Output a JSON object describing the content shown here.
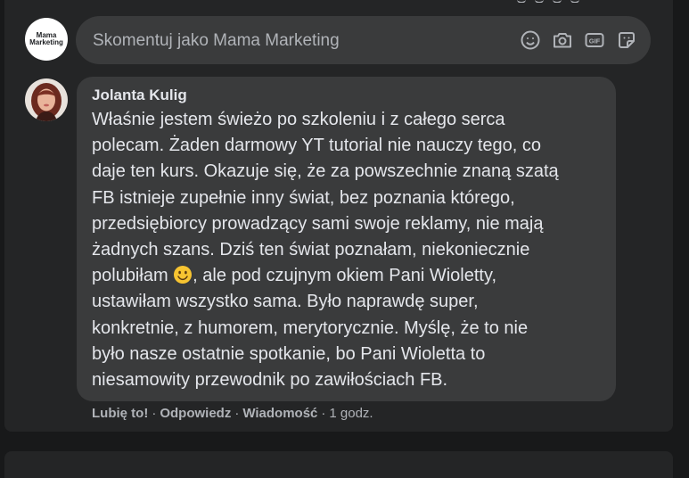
{
  "composer": {
    "placeholder": "Skomentuj jako Mama Marketing",
    "avatar_line1": "Mama",
    "avatar_line2": "Marketing",
    "icons": [
      "emoji-icon",
      "camera-icon",
      "gif-icon",
      "sticker-icon"
    ]
  },
  "comment": {
    "author": "Jolanta Kulig",
    "text_before_emoji": "Właśnie jestem świeżo po szkoleniu i z całego serca\npolecam. Żaden darmowy YT tutorial nie nauczy tego, co\ndaje ten kurs. Okazuje się, że za powszechnie znaną szatą\nFB istnieje zupełnie inny świat, bez poznania którego,\nprzedsiębiorcy prowadzący sami swoje reklamy, nie mają\nżadnych szans. Dziś ten świat poznałam, niekoniecznie\npolubiłam ",
    "text_after_emoji": ", ale pod czujnym okiem Pani Wioletty,\nustawiłam wszystko sama. Było naprawdę super,\nkonkretnie, z humorem, merytorycznie. Myślę, że to nie\nbyło nasze ostatnie spotkanie, bo Pani Wioletta to\nniesamowity przewodnik po zawiłościach FB.",
    "like_label": "Lubię to!",
    "reply_label": "Odpowiedz",
    "message_label": "Wiadomość",
    "time": "1 godz.",
    "separator": "·"
  },
  "colors": {
    "background": "#18191a",
    "card": "#242526",
    "bubble": "#3a3b3c",
    "text": "#e4e6eb",
    "secondary": "#b0b3b8"
  }
}
